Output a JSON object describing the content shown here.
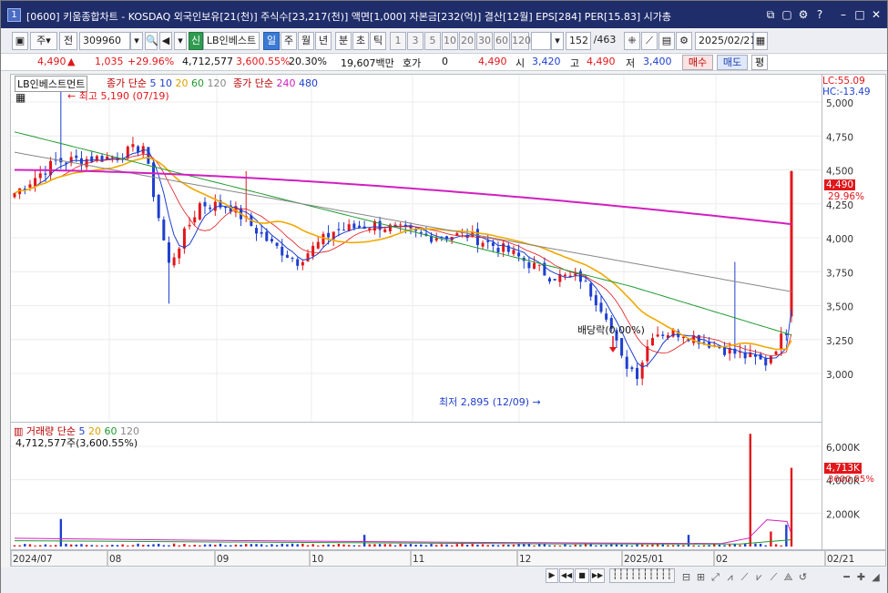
{
  "window": {
    "index": "1",
    "title": "[0600] 키움종합차트 - KOSDAQ 외국인보유[21(천)] 주식수[23,217(천)] 액면[1,000] 자본금[232(억)] 결산[12월] EPS[284] PER[15.83] 시가총"
  },
  "toolbar": {
    "market": "주",
    "prev_label": "전",
    "code": "309960",
    "badge_new": "신",
    "stock_name": "LB인베스트",
    "periods": [
      "일",
      "주",
      "월",
      "년",
      "분",
      "초",
      "틱"
    ],
    "active_period": "일",
    "intervals": [
      "1",
      "3",
      "5",
      "10",
      "20",
      "30",
      "60",
      "120"
    ],
    "count": "152",
    "total": "/463",
    "date": "2025/02/21"
  },
  "quote": {
    "price": "4,490",
    "change": "1,035",
    "change_pct": "+29.96%",
    "volume": "4,712,577",
    "volume_ratio": "3,600.55%",
    "turnover": "20.30%",
    "amount": "19,607백만",
    "hoga_label": "호가",
    "hoga_value": "0",
    "hoga_price": "4,490",
    "open_label": "시",
    "open": "3,420",
    "high_label": "고",
    "high": "4,490",
    "low_label": "저",
    "low": "3,400",
    "buy_label": "매수",
    "sell_label": "매도",
    "flat_label": "평"
  },
  "price_panel": {
    "name_tag": "LB인베스트먼트",
    "legend_ma_short": "종가 단순",
    "legend_ma_short_periods": [
      "5",
      "10",
      "20",
      "60",
      "120"
    ],
    "legend_ma_long": "종가 단순",
    "legend_ma_long_periods": [
      "240",
      "480"
    ],
    "max_label": "최고 5,190 (07/19)",
    "min_label": "최저 2,895 (12/09)",
    "dividend_label": "배당락(0.00%)",
    "lc_label": "LC:55.09",
    "hc_label": "HC:-13.49",
    "last_price_tag": "4,490",
    "last_change_tag": "29.96%"
  },
  "volume_panel": {
    "legend_label": "거래량",
    "legend_ma": "단순",
    "legend_periods": [
      "5",
      "20",
      "60",
      "120"
    ],
    "value_label": "4,712,577주(3,600.55%)",
    "last_volume_tag": "4,713K",
    "last_ratio_tag": "3600.55%"
  },
  "chart_data": {
    "type": "candlestick",
    "y_ticks": [
      "5,000",
      "4,750",
      "4,500",
      "4,250",
      "4,000",
      "3,750",
      "3,500",
      "3,250",
      "3,000"
    ],
    "volume_ticks": [
      "6,000K",
      "4,000K",
      "2,000K"
    ],
    "x_labels": [
      "2024/07",
      "08",
      "09",
      "10",
      "11",
      "12",
      "2025/01",
      "02",
      "02/21"
    ],
    "ylim": [
      2850,
      5200
    ],
    "colors": {
      "up": "#e1171b",
      "down": "#1e3fd0",
      "ma5": "#1e3fd0",
      "ma10": "#e1171b",
      "ma20": "#f0a800",
      "ma60": "#1f9a2f",
      "ma120": "#888888",
      "ma240": "#d020c0"
    },
    "key_points": [
      {
        "label": "high",
        "date": "07/19",
        "value": 5190
      },
      {
        "label": "low",
        "date": "12/09",
        "value": 2895
      },
      {
        "label": "last",
        "date": "02/21",
        "value": 4490
      }
    ]
  },
  "bottom": {
    "buttons": [
      "▶",
      "◀◀",
      "■",
      "▶▶"
    ]
  }
}
